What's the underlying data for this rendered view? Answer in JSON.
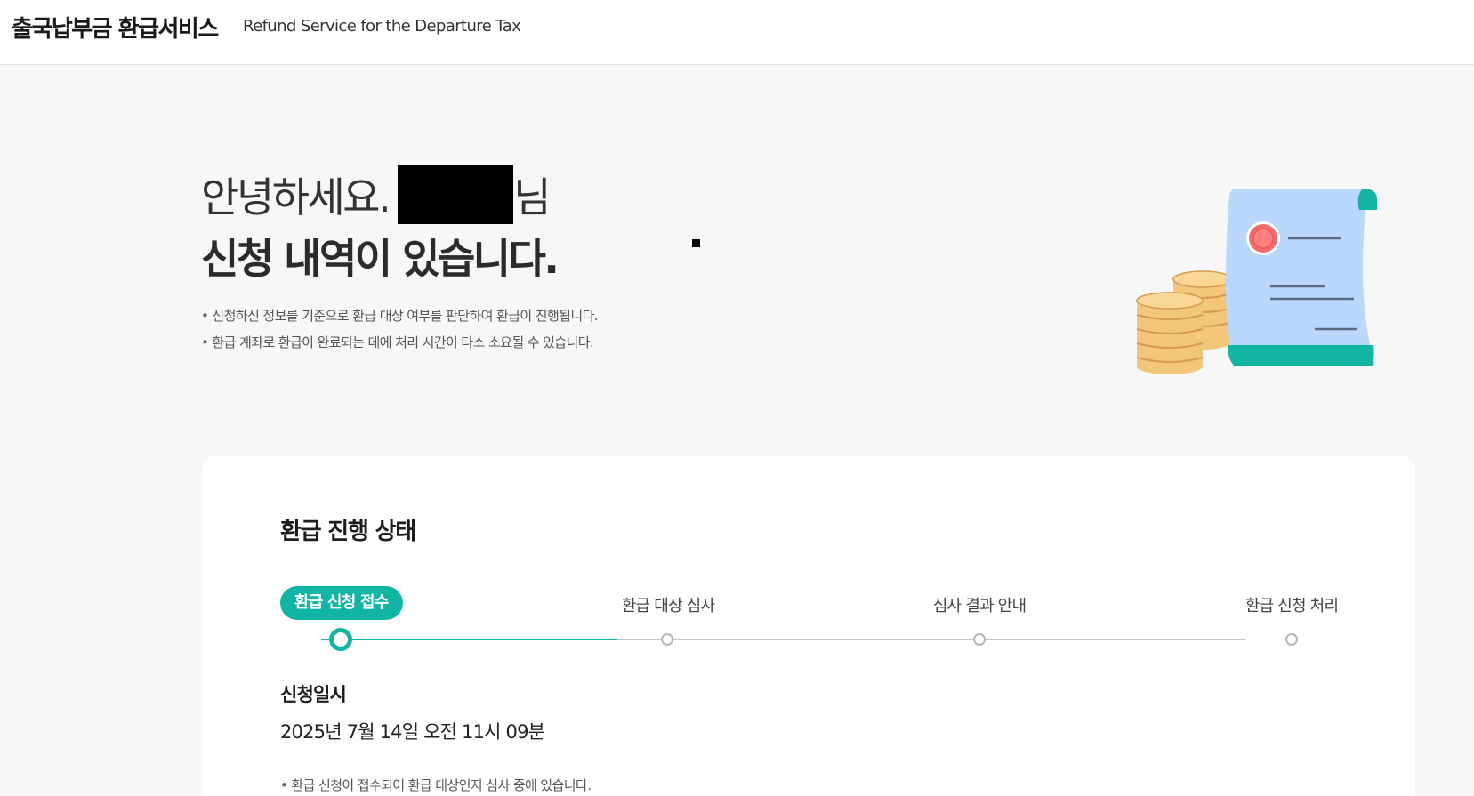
{
  "header": {
    "title_ko": "출국납부금 환급서비스",
    "title_en": "Refund Service for the Departure Tax"
  },
  "greeting": {
    "line1_prefix": "안녕하세요.",
    "line1_suffix": "님",
    "line2": "신청 내역이 있습니다."
  },
  "notes": [
    "신청하신 정보를 기준으로 환급 대상 여부를 판단하여 환급이 진행됩니다.",
    "환급 계좌로 환급이 완료되는 데에 처리 시간이 다소 소요될 수 있습니다."
  ],
  "progress": {
    "title": "환급 진행 상태",
    "current_step": 1,
    "steps": [
      {
        "label": "환급 신청 접수"
      },
      {
        "label": "환급 대상 심사"
      },
      {
        "label": "심사 결과 안내"
      },
      {
        "label": "환급 신청 처리"
      }
    ]
  },
  "application": {
    "date_label": "신청일시",
    "date_value": "2025년 7월 14일 오전 11시 09분",
    "status_note": "환급 신청이 접수되어 환급 대상인지 심사 중에 있습니다."
  },
  "colors": {
    "accent": "#12b5a3",
    "document": "#b9d8fb",
    "seal": "#f26b6b",
    "coin": "#f3c77a"
  },
  "icons": {
    "illustration": "refund-document-coins-illustration"
  }
}
